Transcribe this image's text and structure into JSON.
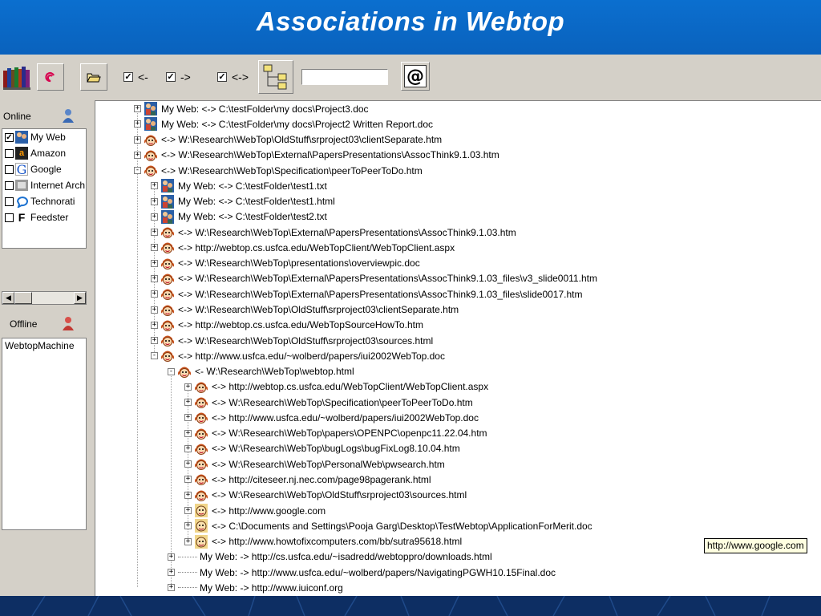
{
  "title": "Associations in Webtop",
  "toolbar": {
    "checks": [
      {
        "label": "<-",
        "checked": true
      },
      {
        "label": "->",
        "checked": true
      },
      {
        "label": "<->",
        "checked": true
      }
    ],
    "search_value": ""
  },
  "left": {
    "online_label": "Online",
    "offline_label": "Offline",
    "online_items": [
      {
        "label": "My Web",
        "checked": true,
        "icon": "people-icon"
      },
      {
        "label": "Amazon",
        "checked": false,
        "icon": "amazon-icon"
      },
      {
        "label": "Google",
        "checked": false,
        "icon": "google-icon"
      },
      {
        "label": "Internet Arch",
        "checked": false,
        "icon": "archive-icon"
      },
      {
        "label": "Technorati",
        "checked": false,
        "icon": "technorati-icon"
      },
      {
        "label": "Feedster",
        "checked": false,
        "icon": "feedster-icon"
      }
    ],
    "offline_items": [
      "WebtopMachine"
    ]
  },
  "tree": [
    {
      "level": 0,
      "exp": "+",
      "icon": "myweb",
      "text": "My Web: <-> C:\\testFolder\\my docs\\Project3.doc"
    },
    {
      "level": 0,
      "exp": "+",
      "icon": "myweb",
      "text": "My Web: <-> C:\\testFolder\\my docs\\Project2 Written Report.doc"
    },
    {
      "level": 0,
      "exp": "+",
      "icon": "face",
      "text": "<-> W:\\Research\\WebTop\\OldStuff\\srproject03\\clientSeparate.htm"
    },
    {
      "level": 0,
      "exp": "+",
      "icon": "face",
      "text": "<-> W:\\Research\\WebTop\\External\\PapersPresentations\\AssocThink9.1.03.htm"
    },
    {
      "level": 0,
      "exp": "-",
      "icon": "face",
      "text": "<-> W:\\Research\\WebTop\\Specification\\peerToPeerToDo.htm"
    },
    {
      "level": 1,
      "exp": "+",
      "icon": "myweb",
      "text": "My Web: <-> C:\\testFolder\\test1.txt"
    },
    {
      "level": 1,
      "exp": "+",
      "icon": "myweb",
      "text": "My Web: <-> C:\\testFolder\\test1.html"
    },
    {
      "level": 1,
      "exp": "+",
      "icon": "myweb",
      "text": "My Web: <-> C:\\testFolder\\test2.txt"
    },
    {
      "level": 1,
      "exp": "+",
      "icon": "face",
      "text": "<-> W:\\Research\\WebTop\\External\\PapersPresentations\\AssocThink9.1.03.htm"
    },
    {
      "level": 1,
      "exp": "+",
      "icon": "face",
      "text": "<-> http://webtop.cs.usfca.edu/WebTopClient/WebTopClient.aspx"
    },
    {
      "level": 1,
      "exp": "+",
      "icon": "face",
      "text": "<-> W:\\Research\\WebTop\\presentations\\overviewpic.doc"
    },
    {
      "level": 1,
      "exp": "+",
      "icon": "face",
      "text": "<-> W:\\Research\\WebTop\\External\\PapersPresentations\\AssocThink9.1.03_files\\v3_slide0011.htm"
    },
    {
      "level": 1,
      "exp": "+",
      "icon": "face",
      "text": "<-> W:\\Research\\WebTop\\External\\PapersPresentations\\AssocThink9.1.03_files\\slide0017.htm"
    },
    {
      "level": 1,
      "exp": "+",
      "icon": "face",
      "text": "<-> W:\\Research\\WebTop\\OldStuff\\srproject03\\clientSeparate.htm"
    },
    {
      "level": 1,
      "exp": "+",
      "icon": "face",
      "text": "<-> http://webtop.cs.usfca.edu/WebTopSourceHowTo.htm"
    },
    {
      "level": 1,
      "exp": "+",
      "icon": "face",
      "text": "<-> W:\\Research\\WebTop\\OldStuff\\srproject03\\sources.html"
    },
    {
      "level": 1,
      "exp": "-",
      "icon": "face",
      "text": "<-> http://www.usfca.edu/~wolberd/papers/iui2002WebTop.doc"
    },
    {
      "level": 2,
      "exp": "-",
      "icon": "face",
      "text": "<- W:\\Research\\WebTop\\webtop.html"
    },
    {
      "level": 3,
      "exp": "+",
      "icon": "face",
      "text": "<-> http://webtop.cs.usfca.edu/WebTopClient/WebTopClient.aspx"
    },
    {
      "level": 3,
      "exp": "+",
      "icon": "face",
      "text": "<-> W:\\Research\\WebTop\\Specification\\peerToPeerToDo.htm"
    },
    {
      "level": 3,
      "exp": "+",
      "icon": "face",
      "text": "<-> http://www.usfca.edu/~wolberd/papers/iui2002WebTop.doc"
    },
    {
      "level": 3,
      "exp": "+",
      "icon": "face",
      "text": "<-> W:\\Research\\WebTop\\papers\\OPENPC\\openpc11.22.04.htm"
    },
    {
      "level": 3,
      "exp": "+",
      "icon": "face",
      "text": "<-> W:\\Research\\WebTop\\bugLogs\\bugFixLog8.10.04.htm"
    },
    {
      "level": 3,
      "exp": "+",
      "icon": "face",
      "text": "<-> W:\\Research\\WebTop\\PersonalWeb\\pwsearch.htm"
    },
    {
      "level": 3,
      "exp": "+",
      "icon": "face",
      "text": "<-> http://citeseer.nj.nec.com/page98pagerank.html"
    },
    {
      "level": 3,
      "exp": "+",
      "icon": "face",
      "text": "<-> W:\\Research\\WebTop\\OldStuff\\srproject03\\sources.html"
    },
    {
      "level": 3,
      "exp": "+",
      "icon": "face2",
      "text": "<-> http://www.google.com"
    },
    {
      "level": 3,
      "exp": "+",
      "icon": "face2",
      "text": "<-> C:\\Documents and Settings\\Pooja Garg\\Desktop\\TestWebtop\\ApplicationForMerit.doc"
    },
    {
      "level": 3,
      "exp": "+",
      "icon": "face2",
      "text": "<-> http://www.howtofixcomputers.com/bb/sutra95618.html"
    },
    {
      "level": 2,
      "exp": "+",
      "icon": "none",
      "text": "My Web:  -> http://cs.usfca.edu/~isadredd/webtoppro/downloads.html"
    },
    {
      "level": 2,
      "exp": "+",
      "icon": "none",
      "text": "My Web:  -> http://www.usfca.edu/~wolberd/papers/NavigatingPGWH10.15Final.doc"
    },
    {
      "level": 2,
      "exp": "+",
      "icon": "none",
      "text": "My Web:  -> http://www.iuiconf.org"
    }
  ],
  "tooltip": "http://www.google.com",
  "colors": {
    "title_bg": "#0a66c2",
    "window_bg": "#d4d0c8",
    "footer_bg": "#0d2e63"
  }
}
